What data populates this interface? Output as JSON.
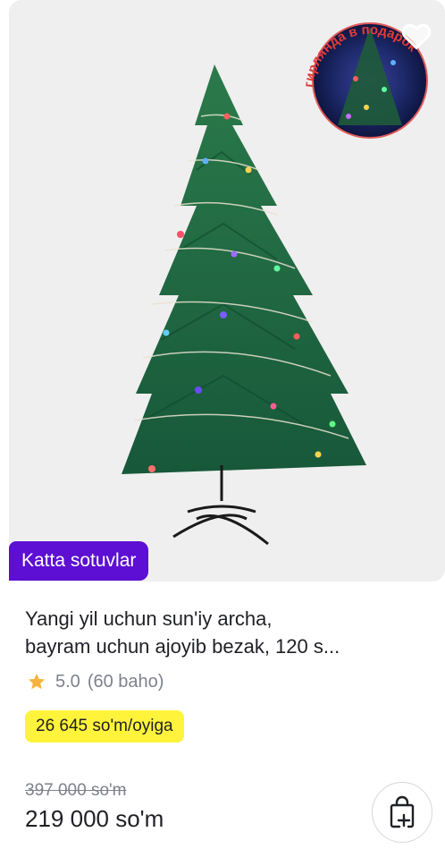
{
  "product": {
    "image_overlay_text": "гирлянда в подарок",
    "badge": "Katta sotuvlar",
    "title_line1": "Yangi yil uchun sun'iy archa,",
    "title_line2": "bayram uchun ajoyib bezak, 120 s...",
    "rating": {
      "score": "5.0",
      "count": "(60 baho)",
      "value": 5.0
    },
    "installment": "26 645 so'm/oyiga",
    "old_price": "397 000 so'm",
    "price": "219 000 so'm"
  },
  "icons": {
    "favorite": "heart-icon",
    "rating": "star-icon",
    "cart": "add-to-cart-bag-icon"
  },
  "colors": {
    "badge_bg": "#5d0fd3",
    "installment_bg": "#fff33b",
    "star": "#f6b33f",
    "tree_green": "#1f6b3f"
  }
}
